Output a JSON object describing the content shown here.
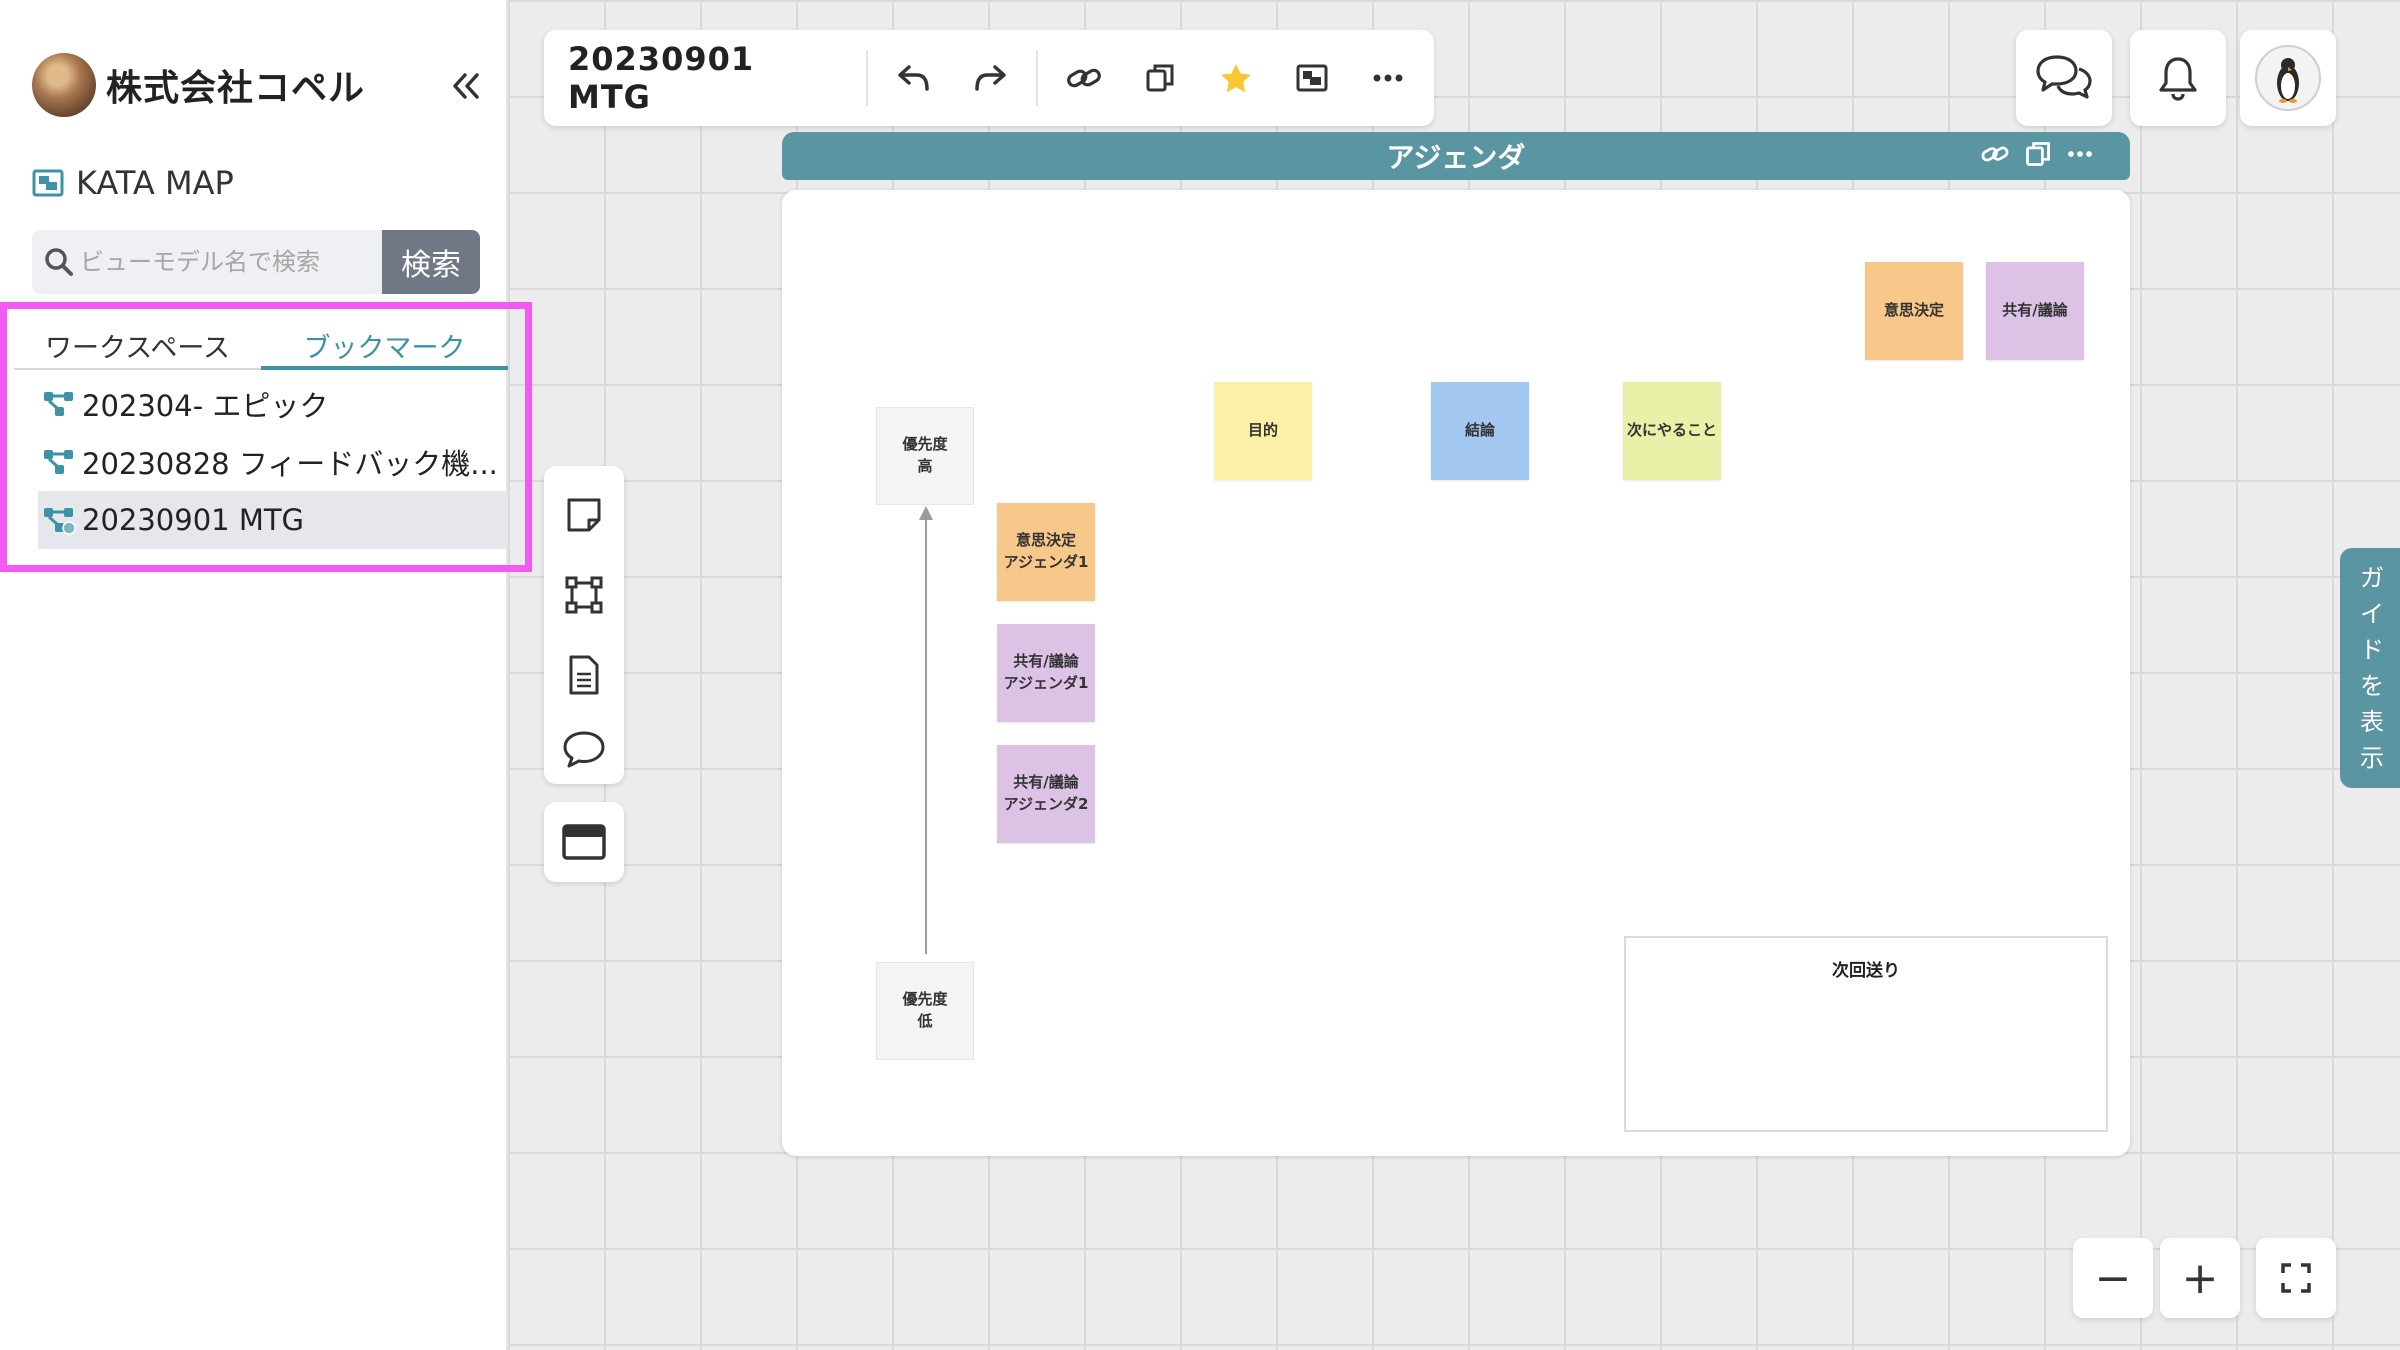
{
  "sidebar": {
    "org_name": "株式会社コペル",
    "product_name": "KATA MAP",
    "search": {
      "placeholder": "ビューモデル名で検索",
      "button_label": "検索"
    },
    "tabs": [
      {
        "label": "ワークスペース",
        "active": false
      },
      {
        "label": "ブックマーク",
        "active": true
      }
    ],
    "items": [
      {
        "label": "202304- エピック",
        "icon": "workflow-icon"
      },
      {
        "label": "20230828 フィードバック機...",
        "icon": "workflow-icon"
      },
      {
        "label": "20230901 MTG",
        "icon": "workflow-shared-icon",
        "selected": true
      }
    ]
  },
  "toolbar": {
    "title": "20230901 MTG",
    "buttons": [
      "undo-icon",
      "redo-icon",
      "link-icon",
      "copy-icon",
      "star-icon",
      "image-icon",
      "more-icon"
    ]
  },
  "frame": {
    "title": "アジェンダ",
    "next_title": "次回送り",
    "priority_high": [
      "優先度",
      "高"
    ],
    "priority_low": [
      "優先度",
      "低"
    ],
    "stickies": [
      {
        "id": "decision-top",
        "lines": [
          "意思決定"
        ],
        "color": "#f7c88a"
      },
      {
        "id": "share-top",
        "lines": [
          "共有/議論"
        ],
        "color": "#dcc3e6"
      },
      {
        "id": "purpose",
        "lines": [
          "目的"
        ],
        "color": "#fbf1a6"
      },
      {
        "id": "conclusion",
        "lines": [
          "結論"
        ],
        "color": "#a2c8f2"
      },
      {
        "id": "next-action",
        "lines": [
          "次にやること"
        ],
        "color": "#e9f0a8"
      },
      {
        "id": "decision-agenda-1",
        "lines": [
          "意思決定",
          "アジェンダ1"
        ],
        "color": "#f7c88a"
      },
      {
        "id": "share-agenda-1",
        "lines": [
          "共有/議論",
          "アジェンダ1"
        ],
        "color": "#dcc3e6"
      },
      {
        "id": "share-agenda-2",
        "lines": [
          "共有/議論",
          "アジェンダ2"
        ],
        "color": "#dcc3e6"
      }
    ]
  },
  "guide_label": "ガイドを表示",
  "zoom": {
    "out": "−",
    "in": "+"
  },
  "colors": {
    "accent": "#5a95a2",
    "highlight": "#f25af2",
    "tab_active": "#3b93a5"
  }
}
